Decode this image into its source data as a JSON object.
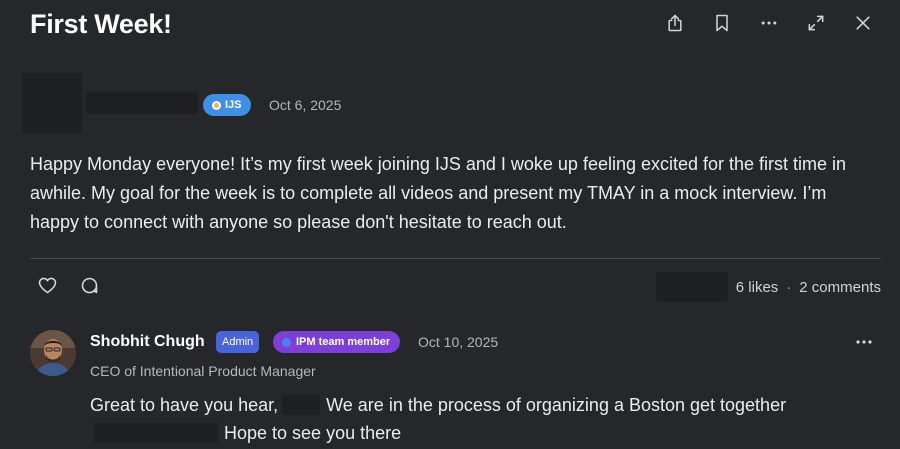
{
  "post": {
    "title": "First Week!",
    "group_badge": "IJS",
    "date": "Oct 6, 2025",
    "body": "Happy Monday everyone! It’s my first week joining IJS and I woke up feeling excited for the first time in awhile. My goal for the week is to complete all videos and present my TMAY in a mock interview. I’m happy to connect with anyone so please don't hesitate to reach out.",
    "likes": "6 likes",
    "separator": "·",
    "comments": "2 comments"
  },
  "toolbar_icons": [
    "share-icon",
    "bookmark-icon",
    "more-icon",
    "expand-icon",
    "close-icon"
  ],
  "comment": {
    "author": "Shobhit Chugh",
    "admin_badge": "Admin",
    "team_badge": "IPM team member",
    "date": "Oct 10, 2025",
    "role": "CEO of Intentional Product Manager",
    "text_part1": "Great to have you hear,",
    "text_part2": "We are in the process of organizing a Boston get together",
    "text_part3": "Hope to see you there"
  },
  "colors": {
    "background": "#26272b",
    "group_badge": "#3f8fe4",
    "admin_badge": "#4b63d8",
    "team_badge": "#7c40d6"
  }
}
